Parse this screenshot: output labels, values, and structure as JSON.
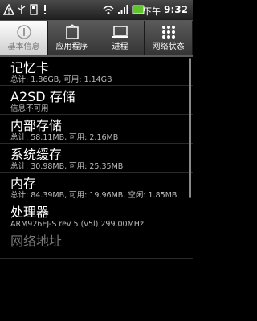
{
  "status_bar": {
    "ampm": "下午",
    "time": "9:32",
    "icons": [
      "warning-icon",
      "usb-icon",
      "usb-connected-icon",
      "alert-icon",
      "wifi-icon",
      "signal-icon",
      "battery-icon"
    ]
  },
  "tabs": [
    {
      "label": "基本信息",
      "icon": "info-icon",
      "active": true
    },
    {
      "label": "应用程序",
      "icon": "apps-icon",
      "active": false
    },
    {
      "label": "进程",
      "icon": "monitor-icon",
      "active": false
    },
    {
      "label": "网络状态",
      "icon": "grid-icon",
      "active": false
    }
  ],
  "items": [
    {
      "title": "记忆卡",
      "sub": "总计: 1.86GB, 可用: 1.14GB"
    },
    {
      "title": "A2SD 存储",
      "sub": "信息不可用"
    },
    {
      "title": "内部存储",
      "sub": "总计: 58.11MB, 可用: 2.16MB"
    },
    {
      "title": "系统缓存",
      "sub": "总计: 30.98MB, 可用: 25.35MB"
    },
    {
      "title": "内存",
      "sub": "总计: 84.39MB, 可用: 19.96MB, 空闲: 1.85MB"
    },
    {
      "title": "处理器",
      "sub": "ARM926EJ-S rev 5 (v5l)  299.00MHz"
    },
    {
      "title": "网络地址",
      "sub": ""
    }
  ]
}
